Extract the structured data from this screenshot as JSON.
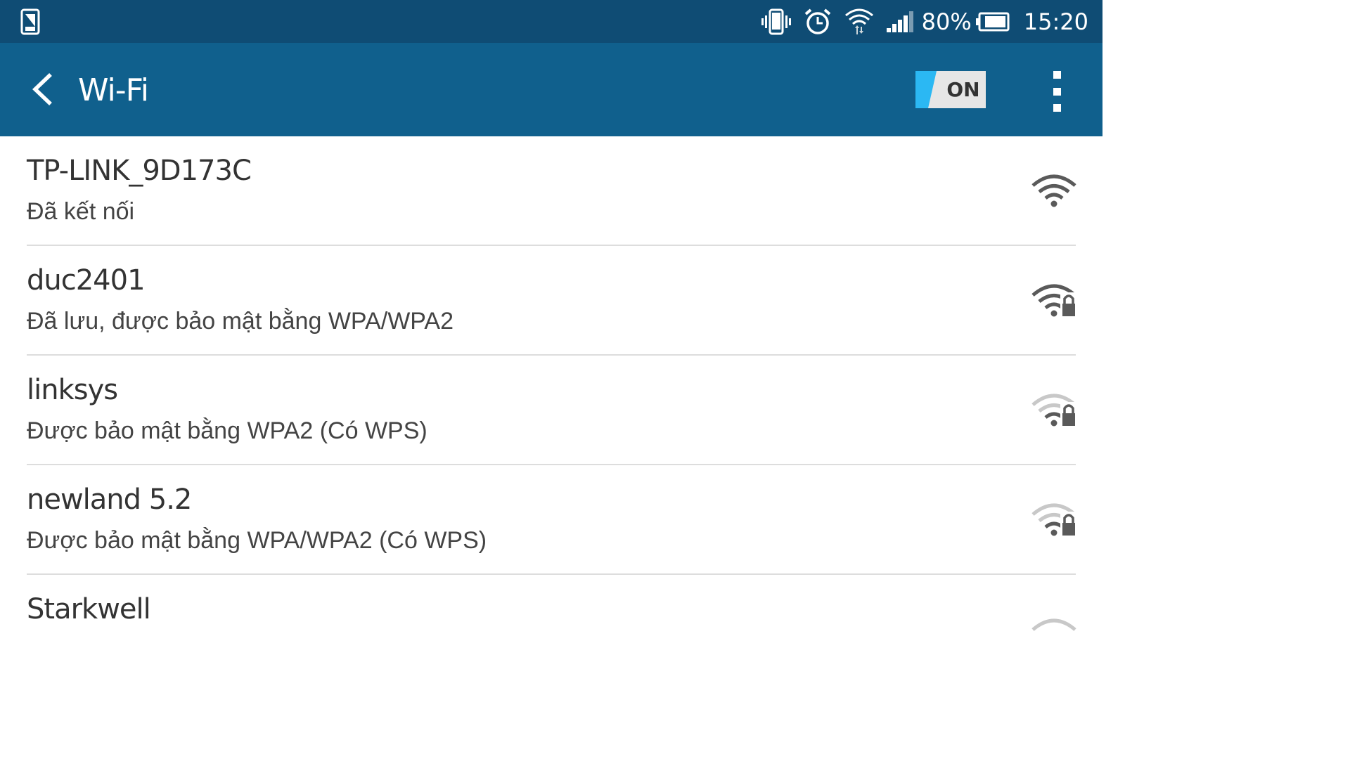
{
  "status_bar": {
    "battery_text": "80%",
    "time": "15:20",
    "icons": [
      "screenshot-icon",
      "vibrate-icon",
      "alarm-icon",
      "wifi-data-icon",
      "cell-signal-icon",
      "battery-icon"
    ]
  },
  "app_bar": {
    "title": "Wi-Fi",
    "toggle_label": "ON",
    "back_icon": "back-arrow-icon",
    "menu_icon": "more-vert-icon"
  },
  "colors": {
    "status_bar": "#0f4c74",
    "app_bar": "#10608d",
    "toggle_accent": "#2bb8f3",
    "signal_strong": "#5a5a5a",
    "signal_weak": "#bdbdbd"
  },
  "networks": [
    {
      "name": "TP-LINK_9D173C",
      "status": "Đã kết nối",
      "icon": "wifi-icon"
    },
    {
      "name": "duc2401",
      "status": "Đã lưu, được bảo mật bằng WPA/WPA2",
      "icon": "wifi-locked-icon"
    },
    {
      "name": "linksys",
      "status": "Được bảo mật bằng WPA2 (Có WPS)",
      "icon": "wifi-locked-icon"
    },
    {
      "name": "newland 5.2",
      "status": "Được bảo mật bằng WPA/WPA2 (Có WPS)",
      "icon": "wifi-locked-icon"
    },
    {
      "name": "Starkwell",
      "status": "",
      "icon": "wifi-icon"
    }
  ]
}
